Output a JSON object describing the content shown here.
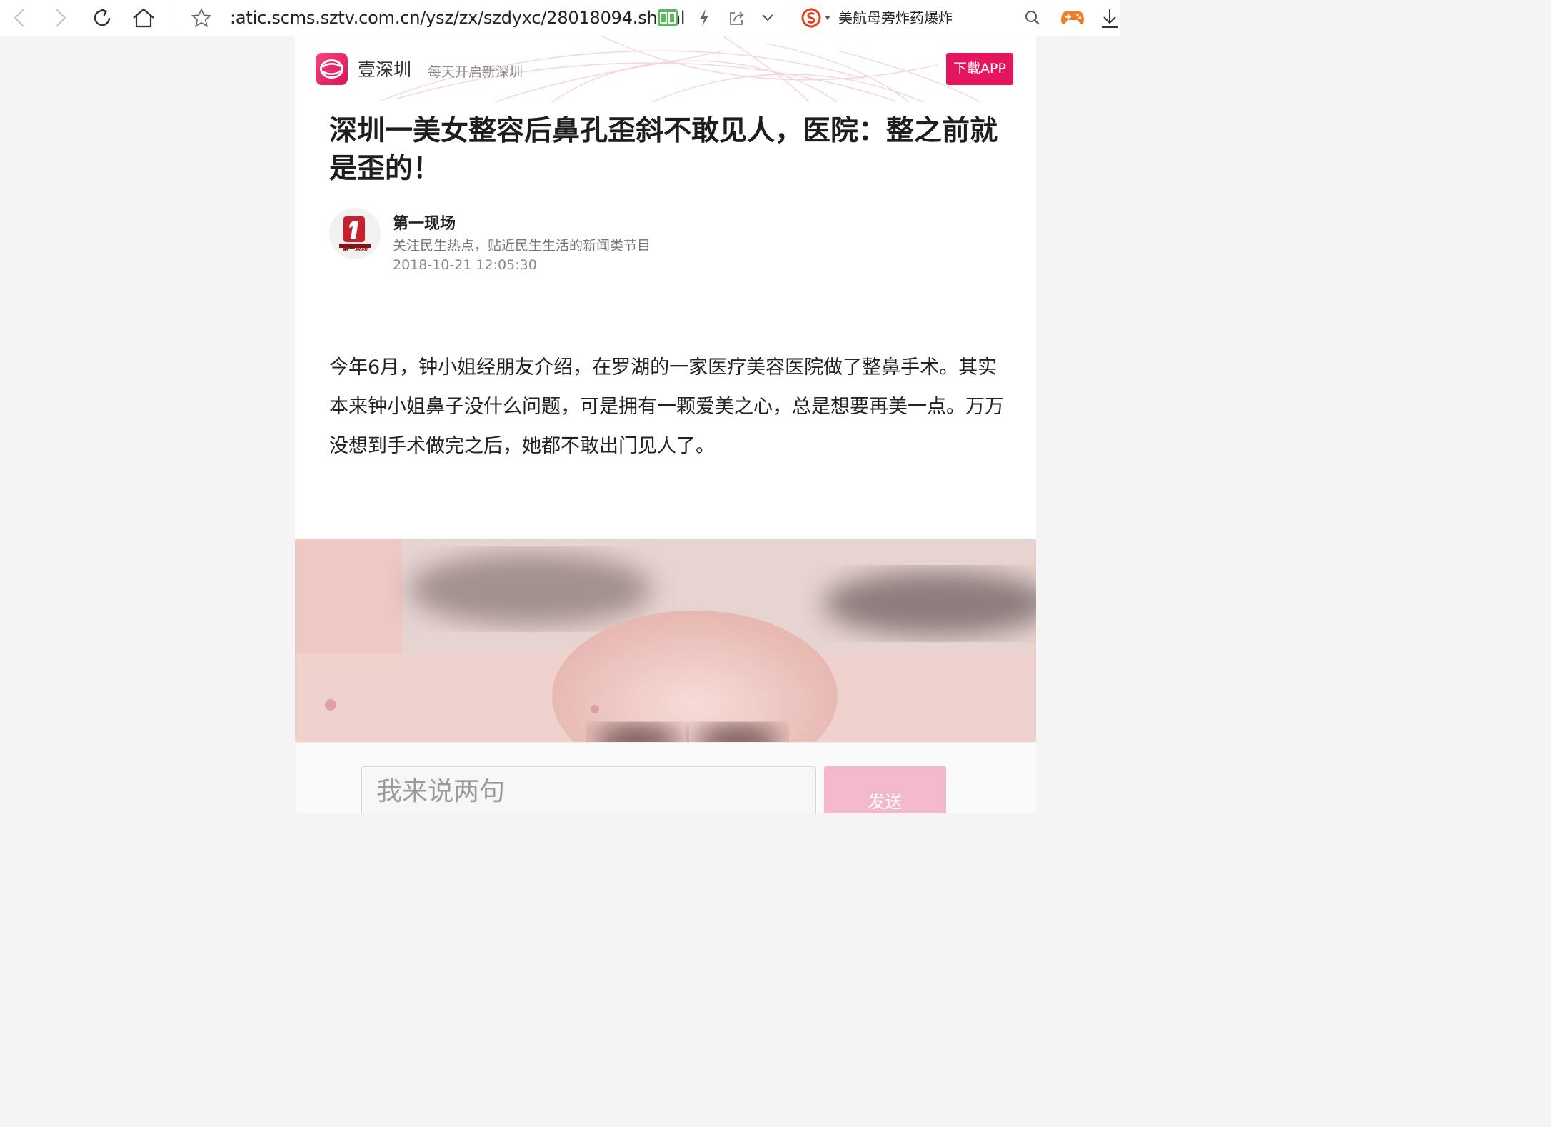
{
  "browser": {
    "url": ":atic.scms.sztv.com.cn/ysz/zx/szdyxc/28018094.shtml",
    "search_text": "美航母旁炸药爆炸"
  },
  "site": {
    "name": "壹深圳",
    "slogan": "每天开启新深圳",
    "download_label": "下载APP",
    "brand_color": "#e5165e"
  },
  "article": {
    "title": "深圳一美女整容后鼻孔歪斜不敢见人，医院：整之前就是歪的！",
    "author": {
      "name": "第一现场",
      "logo_text": "第一现场",
      "description": "关注民生热点，贴近民生生活的新闻类节目"
    },
    "published_at": "2018-10-21 12:05:30",
    "body": "今年6月，钟小姐经朋友介绍，在罗湖的一家医疗美容医院做了整鼻手术。其实本来钟小姐鼻子没什么问题，可是拥有一颗爱美之心，总是想要再美一点。万万没想到手术做完之后，她都不敢出门见人了。"
  },
  "comment": {
    "placeholder": "我来说两句",
    "send_label": "发送"
  }
}
